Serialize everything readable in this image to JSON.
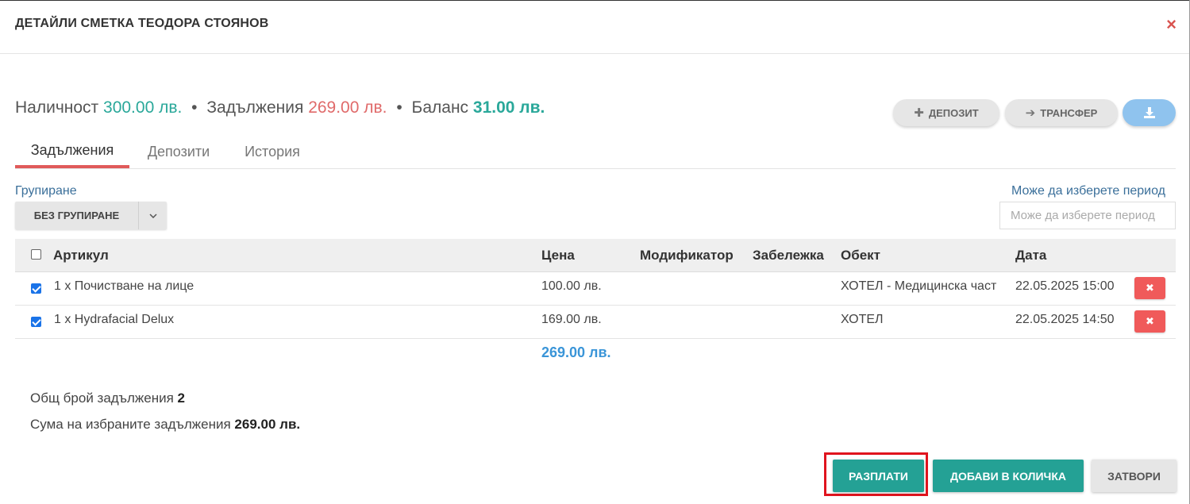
{
  "dialog": {
    "title": "ДЕТАЙЛИ СМЕТКА ТЕОДОРА СТОЯНОВ",
    "close_icon": "×"
  },
  "summary": {
    "available_label": "Наличност",
    "available_value": "300.00 лв.",
    "sep1": "•",
    "debts_label": "Задължения",
    "debts_value": "269.00 лв.",
    "sep2": "•",
    "balance_label": "Баланс",
    "balance_value": "31.00 лв."
  },
  "actions": {
    "deposit_icon": "✚",
    "deposit_label": "ДЕПОЗИТ",
    "transfer_icon": "➔",
    "transfer_label": "ТРАНСФЕР",
    "download_icon": "download-icon"
  },
  "tabs": [
    {
      "label": "Задължения",
      "active": true
    },
    {
      "label": "Депозити",
      "active": false
    },
    {
      "label": "История",
      "active": false
    }
  ],
  "grouping": {
    "label": "Групиране",
    "value": "БЕЗ ГРУПИРАНЕ",
    "chevron": "⌄"
  },
  "period": {
    "label": "Може да изберете период",
    "placeholder": "Може да изберете период"
  },
  "table": {
    "headers": {
      "item": "Артикул",
      "price": "Цена",
      "modifier": "Модификатор",
      "note": "Забележка",
      "object": "Обект",
      "date": "Дата"
    },
    "rows": [
      {
        "checked": true,
        "item": "1 x Почистване на лице",
        "price": "100.00 лв.",
        "modifier": "",
        "note": "",
        "object": "ХОТЕЛ - Медицинска част",
        "date": "22.05.2025 15:00",
        "delete_icon": "✖"
      },
      {
        "checked": true,
        "item": "1 x Hydrafacial Delux",
        "price": "169.00 лв.",
        "modifier": "",
        "note": "",
        "object": "ХОТЕЛ",
        "date": "22.05.2025 14:50",
        "delete_icon": "✖"
      }
    ],
    "total": "269.00 лв."
  },
  "stats": {
    "count_label": "Общ брой задължения",
    "count_value": "2",
    "sum_label": "Сума на избраните задължения",
    "sum_value": "269.00 лв."
  },
  "footer": {
    "pay_label": "РАЗПЛАТИ",
    "cart_label": "ДОБАВИ В КОЛИЧКА",
    "close_label": "ЗАТВОРИ"
  },
  "colors": {
    "accent_green": "#24a195",
    "debt_red": "#e06a6a",
    "link_blue": "#3a6f9a",
    "total_blue": "#3a95d8",
    "delete_red": "#f05a5a",
    "highlight_frame": "#e0141e"
  }
}
